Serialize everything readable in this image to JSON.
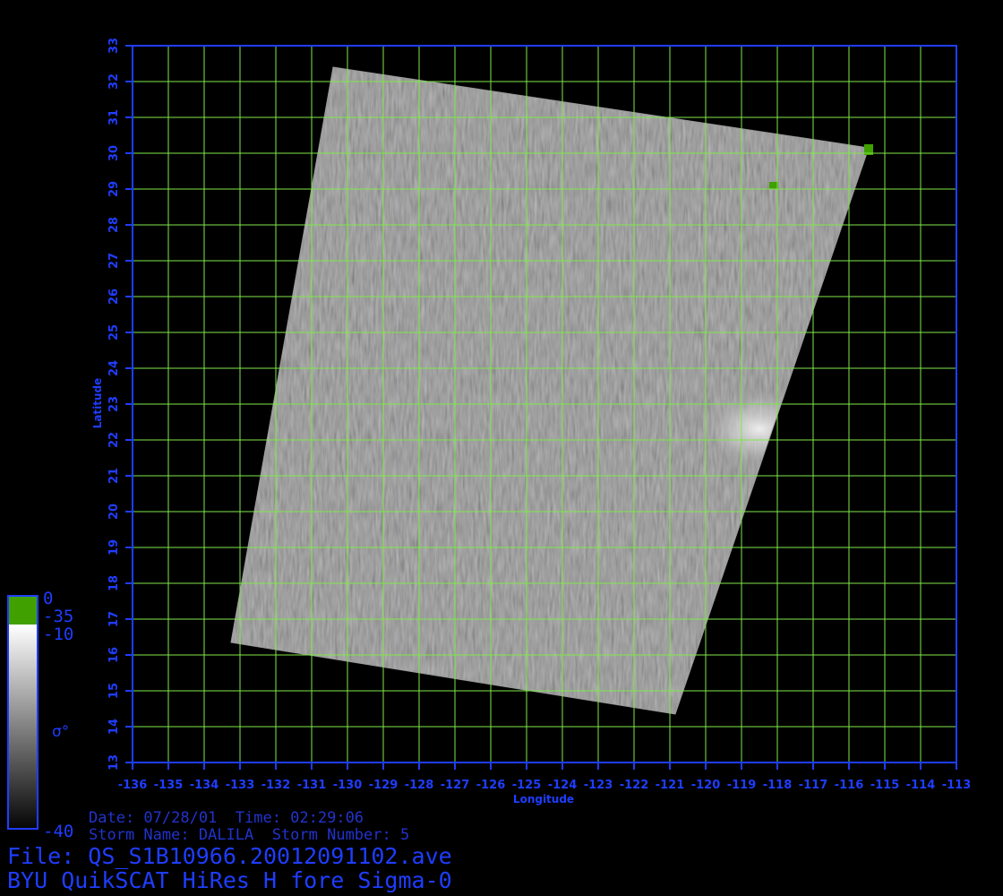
{
  "map": {
    "xlabel": "Longitude",
    "ylabel": "Latitude",
    "lon_range": [
      -136,
      -113
    ],
    "lat_range": [
      13,
      33
    ],
    "lon_ticks": [
      -136,
      -135,
      -134,
      -133,
      -132,
      -131,
      -130,
      -129,
      -128,
      -127,
      -126,
      -125,
      -124,
      -123,
      -122,
      -121,
      -120,
      -119,
      -118,
      -117,
      -116,
      -115,
      -114,
      -113
    ],
    "lat_ticks": [
      13,
      14,
      15,
      16,
      17,
      18,
      19,
      20,
      21,
      22,
      23,
      24,
      25,
      26,
      27,
      28,
      29,
      30,
      31,
      32,
      33
    ],
    "grid": true,
    "swath_corners": [
      {
        "lon": -130.4,
        "lat": 32.4
      },
      {
        "lon": -115.45,
        "lat": 30.15
      },
      {
        "lon": -120.85,
        "lat": 14.35
      },
      {
        "lon": -133.25,
        "lat": 16.35
      }
    ],
    "bright_spot": {
      "lon": -118.5,
      "lat": 22.3
    },
    "colors": {
      "axis": "#1f3dff",
      "grid": "#7fe84a",
      "text": "#1f3dff",
      "land_flag": "#3fa000"
    }
  },
  "colorbar": {
    "top_label": "0",
    "flag_label": "-35",
    "upper_label": "-10",
    "lower_label": "-40",
    "symbol": "σ°"
  },
  "info": {
    "date_line": "Date: 07/28/01  Time: 02:29:06",
    "storm_line": "Storm Name: DALILA  Storm Number: 5",
    "file_line": "File: QS_S1B10966.20012091102.ave",
    "product_line": "BYU QuikSCAT HiRes H fore Sigma-0"
  }
}
